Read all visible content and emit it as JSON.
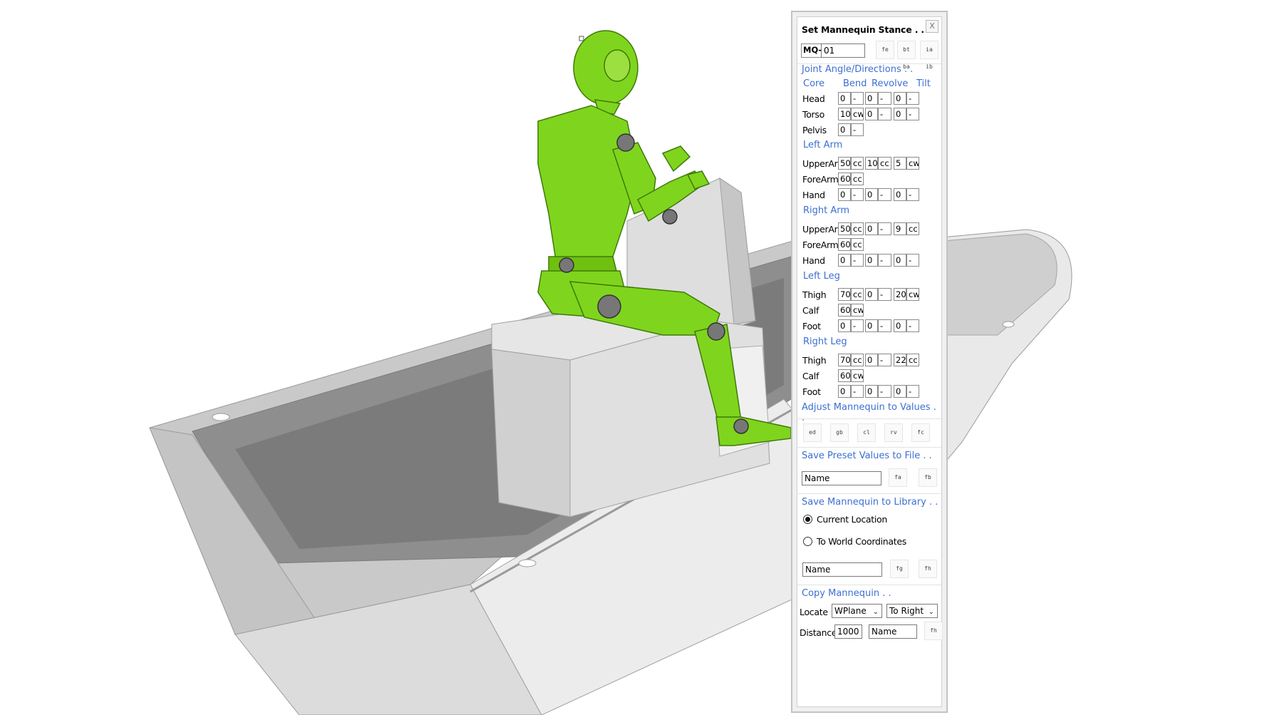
{
  "panel": {
    "title": "Set Mannequin Stance . .",
    "close": "X",
    "mq_prefix": "MQ-",
    "mq_value": "01",
    "top_buttons": [
      "fe",
      "bt ba",
      "ia ib"
    ],
    "joint_section": "Joint Angle/Directions . .",
    "columns": {
      "core": "Core",
      "bend": "Bend",
      "revolve": "Revolve",
      "tilt": "Tilt"
    },
    "core_rows": [
      {
        "label": "Head",
        "b": "0",
        "bd": "-",
        "r": "0",
        "rd": "-",
        "t": "0",
        "td": "-"
      },
      {
        "label": "Torso",
        "b": "10",
        "bd": "cw",
        "r": "0",
        "rd": "-",
        "t": "0",
        "td": "-"
      },
      {
        "label": "Pelvis",
        "b": "0",
        "bd": "-"
      }
    ],
    "left_arm_title": "Left Arm",
    "left_arm": [
      {
        "label": "UpperArm",
        "b": "50",
        "bd": "cc",
        "r": "10",
        "rd": "cc",
        "t": "5",
        "td": "cw"
      },
      {
        "label": "ForeArm",
        "b": "60",
        "bd": "cc"
      },
      {
        "label": "Hand",
        "b": "0",
        "bd": "-",
        "r": "0",
        "rd": "-",
        "t": "0",
        "td": "-"
      }
    ],
    "right_arm_title": "Right Arm",
    "right_arm": [
      {
        "label": "UpperArm",
        "b": "50",
        "bd": "cc",
        "r": "0",
        "rd": "-",
        "t": "9",
        "td": "cc"
      },
      {
        "label": "ForeArm",
        "b": "60",
        "bd": "cc"
      },
      {
        "label": "Hand",
        "b": "0",
        "bd": "-",
        "r": "0",
        "rd": "-",
        "t": "0",
        "td": "-"
      }
    ],
    "left_leg_title": "Left Leg",
    "left_leg": [
      {
        "label": "Thigh",
        "b": "70",
        "bd": "cc",
        "r": "0",
        "rd": "-",
        "t": "20",
        "td": "cw"
      },
      {
        "label": "Calf",
        "b": "60",
        "bd": "cw"
      },
      {
        "label": "Foot",
        "b": "0",
        "bd": "-",
        "r": "0",
        "rd": "-",
        "t": "0",
        "td": "-"
      }
    ],
    "right_leg_title": "Right Leg",
    "right_leg": [
      {
        "label": "Thigh",
        "b": "70",
        "bd": "cc",
        "r": "0",
        "rd": "-",
        "t": "22",
        "td": "cc"
      },
      {
        "label": "Calf",
        "b": "60",
        "bd": "cw"
      },
      {
        "label": "Foot",
        "b": "0",
        "bd": "-",
        "r": "0",
        "rd": "-",
        "t": "0",
        "td": "-"
      }
    ],
    "adjust_title": "Adjust Mannequin to Values . .",
    "adjust_buttons": [
      "ed",
      "gb",
      "cl",
      "rv",
      "fc"
    ],
    "preset_title": "Save Preset Values to File . .",
    "preset_name": "Name",
    "preset_buttons": [
      "fa",
      "fb"
    ],
    "library_title": "Save Mannequin to Library . .",
    "radio_current": "Current Location",
    "radio_world": "To World Coordinates",
    "library_name": "Name",
    "library_buttons": [
      "fg",
      "fh"
    ],
    "copy_title": "Copy Mannequin . .",
    "locate_label": "Locate",
    "locate_value": "WPlane",
    "direction_value": "To Right",
    "distance_label": "Distance",
    "distance_value": "1000",
    "copy_name": "Name",
    "copy_button": "fh"
  },
  "colors": {
    "mannequin": "#7fd51d",
    "boat": "#d6d6d6",
    "accent": "#3d6fd1"
  }
}
